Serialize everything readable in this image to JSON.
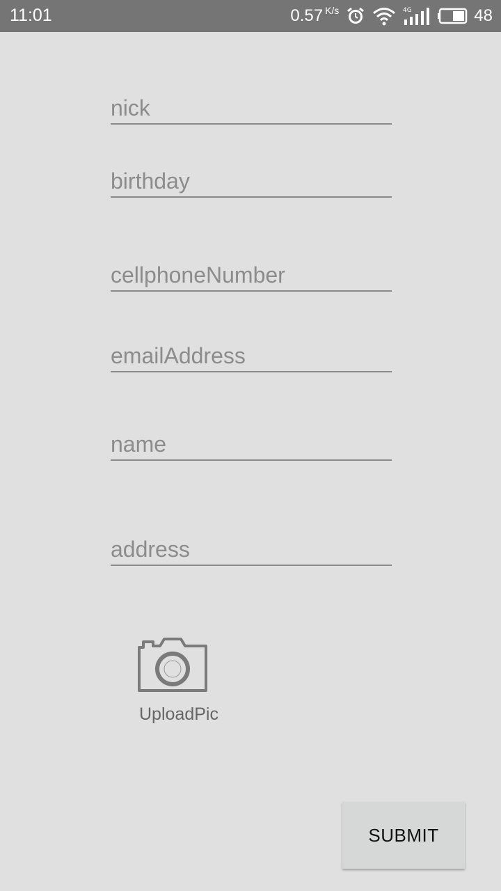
{
  "status_bar": {
    "time": "11:01",
    "net_speed": "0.57",
    "net_speed_unit": "K/s",
    "network_type": "4G",
    "battery_level": "48",
    "background_color": "#757575"
  },
  "form": {
    "fields": [
      {
        "key": "nick",
        "placeholder": "nick",
        "value": ""
      },
      {
        "key": "birthday",
        "placeholder": "birthday",
        "value": ""
      },
      {
        "key": "cellphone",
        "placeholder": "cellphoneNumber",
        "value": ""
      },
      {
        "key": "email",
        "placeholder": "emailAddress",
        "value": ""
      },
      {
        "key": "name",
        "placeholder": "name",
        "value": ""
      },
      {
        "key": "address",
        "placeholder": "address",
        "value": ""
      }
    ],
    "upload": {
      "icon": "camera-icon",
      "label": "UploadPic"
    },
    "submit_label": "SUBMIT"
  },
  "colors": {
    "background": "#e0e0e0",
    "underline": "#8a8a8a",
    "placeholder": "#8c8c8c",
    "button": "#d6d7d7"
  }
}
